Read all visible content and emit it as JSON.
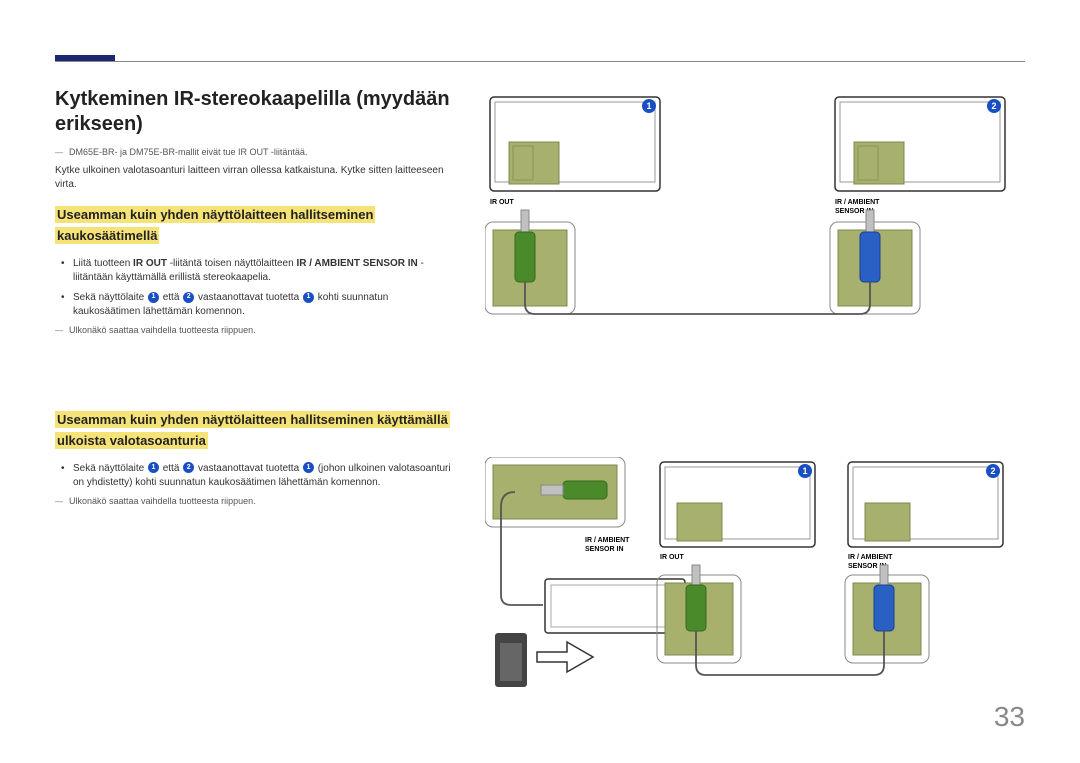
{
  "title": "Kytkeminen IR-stereokaapelilla (myydään erikseen)",
  "note_models": "DM65E-BR- ja DM75E-BR-mallit eivät tue IR OUT -liitäntää.",
  "note_models_bold": "IR OUT",
  "intro": "Kytke ulkoinen valotasoanturi laitteen virran ollessa katkaistuna. Kytke sitten laitteeseen virta.",
  "section1": {
    "heading": "Useamman kuin yhden näyttölaitteen hallitseminen kaukosäätimellä",
    "bullet1_pre": "Liitä tuotteen ",
    "bullet1_b1": "IR OUT",
    "bullet1_mid": " -liitäntä toisen näyttölaitteen ",
    "bullet1_b2": "IR / AMBIENT SENSOR IN",
    "bullet1_post": " -liitäntään käyttämällä erillistä stereokaapelia.",
    "bullet2_a": "Sekä näyttölaite ",
    "bullet2_b": " että ",
    "bullet2_c": " vastaanottavat tuotetta ",
    "bullet2_d": " kohti suunnatun kaukosäätimen lähettämän komennon.",
    "note": "Ulkonäkö saattaa vaihdella tuotteesta riippuen."
  },
  "section2": {
    "heading": "Useamman kuin yhden näyttölaitteen hallitseminen käyttämällä ulkoista valotasoanturia",
    "bullet1_a": "Sekä näyttölaite ",
    "bullet1_b": " että ",
    "bullet1_c": " vastaanottavat tuotetta ",
    "bullet1_d": " (johon ulkoinen valotasoanturi on yhdistetty) kohti suunnatun kaukosäätimen lähettämän komennon.",
    "note": "Ulkonäkö saattaa vaihdella tuotteesta riippuen."
  },
  "labels": {
    "ir_out": "IR OUT",
    "ir_ambient": "IR / AMBIENT",
    "sensor_in": "SENSOR IN"
  },
  "badges": {
    "one": "1",
    "two": "2"
  },
  "page_number": "33"
}
